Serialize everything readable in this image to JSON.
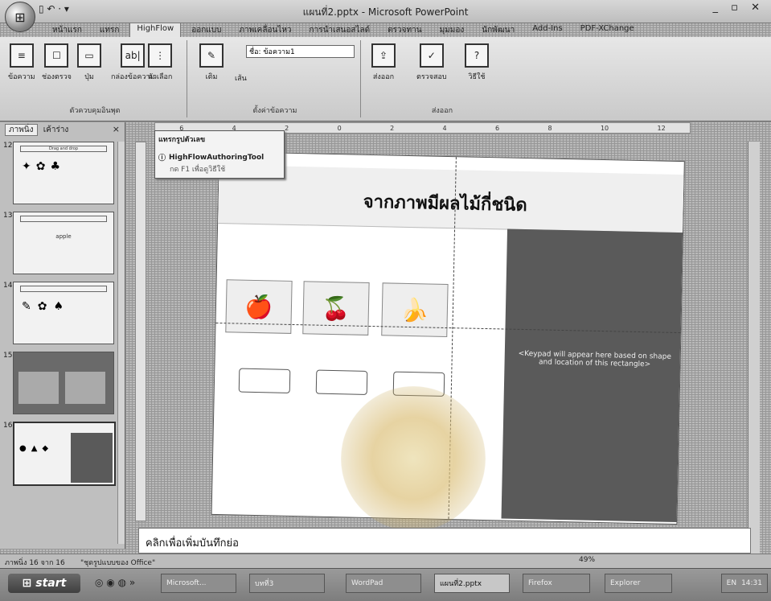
{
  "window": {
    "title": "แผนที่2.pptx - Microsoft PowerPoint",
    "controls": "_ ▫ ✕"
  },
  "qat": {
    "label": "▯ ↶ · ▾"
  },
  "ribbon": {
    "tabs": [
      "หน้าแรก",
      "แทรก",
      "HighFlow",
      "ออกแบบ",
      "ภาพเคลื่อนไหว",
      "การนำเสนอสไลด์",
      "ตรวจทาน",
      "มุมมอง",
      "นักพัฒนา",
      "Add-Ins",
      "PDF-XChange"
    ],
    "active_tab": "HighFlow",
    "groups": {
      "insert": {
        "buttons": [
          "ข้อความ",
          "ช่องตรวจ",
          "ปุ่ม",
          "กล่องข้อความ",
          "ตัวเลือก"
        ],
        "label": "ตัวควบคุมอินพุต"
      },
      "format": {
        "label": "ตั้งค่าข้อความ",
        "field": "ชื่อ: ข้อความ1",
        "buttons": [
          "เติม",
          "เส้น"
        ]
      },
      "help": {
        "buttons": [
          "ส่งออก",
          "ตรวจสอบ",
          "วิธีใช้"
        ],
        "label": "ส่งออก"
      }
    }
  },
  "left_pane": {
    "tabs": [
      "ภาพนิ่ง",
      "เค้าร่าง"
    ],
    "close": "×",
    "slides": [
      {
        "num": "12",
        "title": "Drag and drop"
      },
      {
        "num": "13",
        "title": "",
        "text": "apple"
      },
      {
        "num": "14",
        "title": ""
      },
      {
        "num": "15",
        "title": ""
      },
      {
        "num": "16",
        "title": ""
      }
    ]
  },
  "ruler": {
    "ticks": [
      "6",
      "4",
      "2",
      "0",
      "2",
      "4",
      "6",
      "8",
      "10",
      "12"
    ]
  },
  "popup": {
    "header": "แทรกรูปตัวเลข",
    "item": "HighFlowAuthoringTool",
    "note": "กด F1 เพื่อดูวิธีใช้"
  },
  "slide": {
    "title": "จากภาพมีผลไม้กี่ชนิด",
    "fruits": [
      "🍎",
      "🍒",
      "🍌"
    ],
    "keypad_text": "<Keypad will appear here based on shape and location of this rectangle>"
  },
  "notes": {
    "placeholder": "คลิกเพื่อเพิ่มบันทึกย่อ"
  },
  "status": {
    "slide_info": "ภาพนิ่ง 16 จาก 16",
    "theme": "\"ชุดรูปแบบของ Office\"",
    "zoom": "49%"
  },
  "taskbar": {
    "start": "start",
    "items": [
      "Microsoft...",
      "บทที่3",
      "WordPad",
      "แผนที่2.pptx",
      "Firefox",
      "Explorer"
    ],
    "clock": "14:31",
    "tray_lang": "EN"
  }
}
